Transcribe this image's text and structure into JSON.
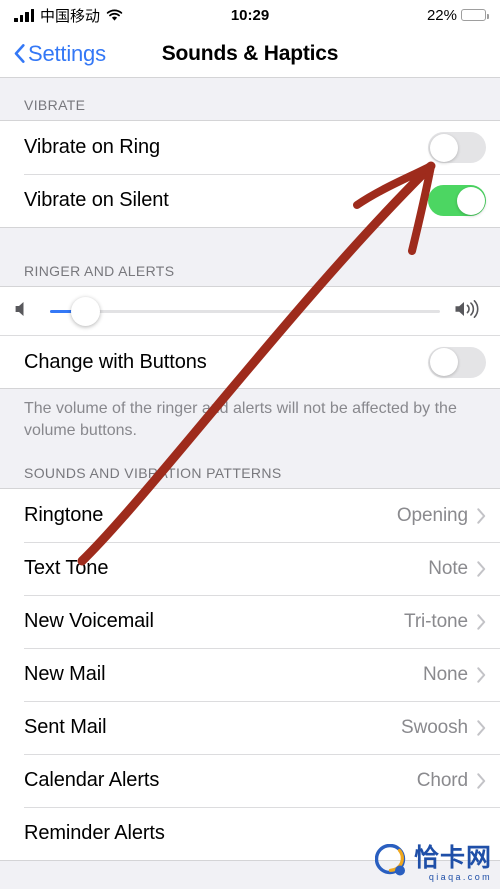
{
  "status_bar": {
    "carrier": "中国移动",
    "signal_icon": "signal-bars-icon",
    "wifi_icon": "wifi-icon",
    "time": "10:29",
    "battery_percent": "22%",
    "battery_level": 22,
    "battery_color": "#FDBE2E"
  },
  "nav": {
    "back_label": "Settings",
    "back_icon": "chevron-left-icon",
    "title": "Sounds & Haptics",
    "tint_color": "#3478F6"
  },
  "sections": {
    "vibrate": {
      "header": "VIBRATE",
      "rows": [
        {
          "label": "Vibrate on Ring",
          "toggle": "off"
        },
        {
          "label": "Vibrate on Silent",
          "toggle": "on"
        }
      ]
    },
    "ringer": {
      "header": "RINGER AND ALERTS",
      "slider": {
        "low_icon": "speaker-low-icon",
        "high_icon": "speaker-high-icon",
        "value_percent": 9
      },
      "change_with_buttons": {
        "label": "Change with Buttons",
        "toggle": "off"
      },
      "footnote": "The volume of the ringer and alerts will not be affected by the volume buttons."
    },
    "sounds": {
      "header": "SOUNDS AND VIBRATION PATTERNS",
      "rows": [
        {
          "label": "Ringtone",
          "value": "Opening"
        },
        {
          "label": "Text Tone",
          "value": "Note"
        },
        {
          "label": "New Voicemail",
          "value": "Tri-tone"
        },
        {
          "label": "New Mail",
          "value": "None"
        },
        {
          "label": "Sent Mail",
          "value": "Swoosh"
        },
        {
          "label": "Calendar Alerts",
          "value": "Chord"
        },
        {
          "label": "Reminder Alerts",
          "value": ""
        }
      ]
    }
  },
  "annotation": {
    "type": "arrow",
    "color": "#9E2B1C",
    "points_to": "Vibrate on Ring toggle"
  },
  "watermark": {
    "name_cn": "恰卡网",
    "name_en": "qiaqa.com",
    "color": "#1F4FA8"
  }
}
